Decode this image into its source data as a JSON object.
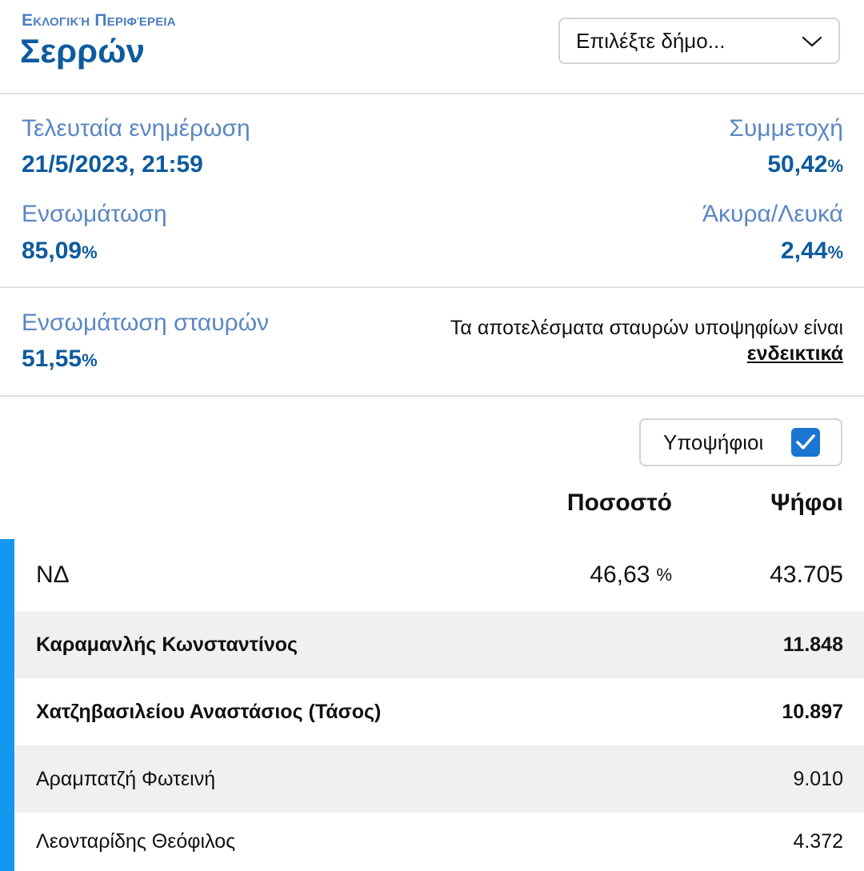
{
  "header": {
    "subtitle": "Εκλογική Περιφέρεια",
    "title": "Σερρών",
    "municipality_select": {
      "placeholder": "Επιλέξτε δήμο...",
      "icon": "chevron-down-icon"
    }
  },
  "stats": {
    "last_update_label": "Τελευταία ενημέρωση",
    "last_update_value": "21/5/2023, 21:59",
    "turnout_label": "Συμμετοχή",
    "turnout_value": "50,42",
    "integration_label": "Ενσωμάτωση",
    "integration_value": "85,09",
    "invalid_label": "Άκυρα/Λευκά",
    "invalid_value": "2,44",
    "pct_sign": "%"
  },
  "preferences": {
    "label": "Ενσωμάτωση σταυρών",
    "value": "51,55",
    "note_text": "Τα αποτελέσματα σταυρών υποψηφίων είναι",
    "note_link": "ενδεικτικά"
  },
  "candidates_toggle": {
    "label": "Υποψήφιοι",
    "checked": true
  },
  "table": {
    "headers": {
      "percent": "Ποσοστό",
      "votes": "Ψήφοι"
    },
    "accent_color": "#1597ef",
    "party": {
      "name": "ΝΔ",
      "percent": "46,63",
      "pct_sign": "%",
      "votes": "43.705"
    },
    "candidates": [
      {
        "name": "Καραμανλής Κωνσταντίνος",
        "votes": "11.848",
        "bold": true
      },
      {
        "name": "Χατζηβασιλείου Αναστάσιος (Τάσος)",
        "votes": "10.897",
        "bold": true
      },
      {
        "name": "Αραμπατζή Φωτεινή",
        "votes": "9.010",
        "bold": false
      },
      {
        "name": "Λεονταρίδης Θεόφιλος",
        "votes": "4.372",
        "bold": false
      }
    ]
  }
}
